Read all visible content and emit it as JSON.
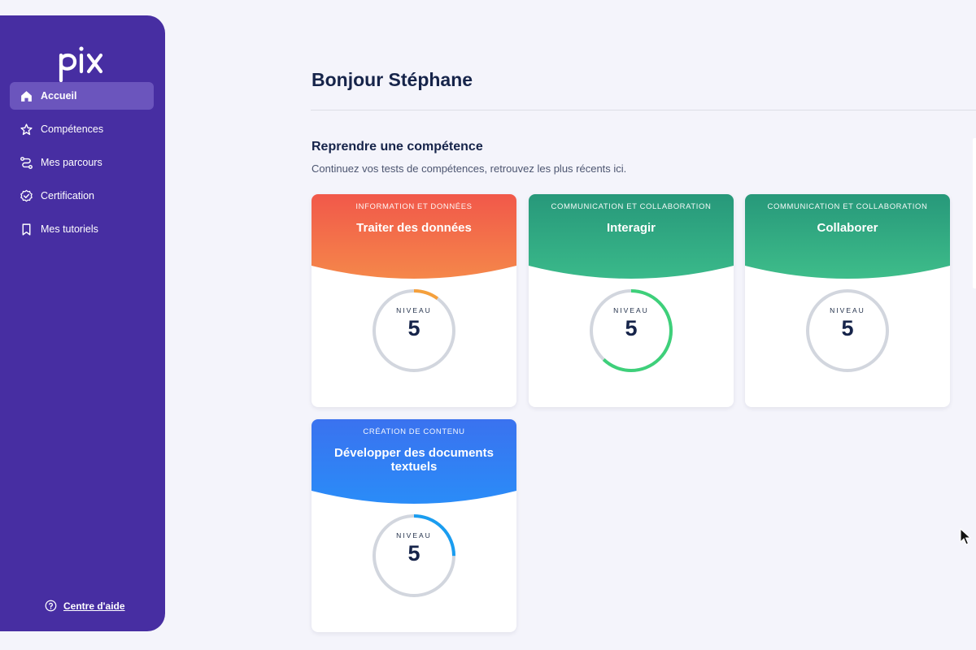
{
  "brand": {
    "logo_text": "pix"
  },
  "sidebar": {
    "items": [
      {
        "label": "Accueil",
        "icon": "home-icon",
        "active": true
      },
      {
        "label": "Compétences",
        "icon": "star-icon",
        "active": false
      },
      {
        "label": "Mes parcours",
        "icon": "route-icon",
        "active": false
      },
      {
        "label": "Certification",
        "icon": "badge-check-icon",
        "active": false
      },
      {
        "label": "Mes tutoriels",
        "icon": "bookmark-icon",
        "active": false
      }
    ],
    "help_label": "Centre d'aide"
  },
  "main": {
    "greeting": "Bonjour Stéphane",
    "section_title": "Reprendre une compétence",
    "section_subtitle": "Continuez vos tests de compétences, retrouvez les plus récents ici."
  },
  "cards": [
    {
      "area": "INFORMATION ET DONNÉES",
      "name": "Traiter des données",
      "level_label": "NIVEAU",
      "level": "5",
      "progress": 0.1,
      "colors": [
        "#f1584a",
        "#f5874a"
      ],
      "progress_color": "#f5a03c"
    },
    {
      "area": "COMMUNICATION ET COLLABORATION",
      "name": "Interagir",
      "level_label": "NIVEAU",
      "level": "5",
      "progress": 0.62,
      "colors": [
        "#27987a",
        "#3ab98a"
      ],
      "progress_color": "#3ed07a"
    },
    {
      "area": "COMMUNICATION ET COLLABORATION",
      "name": "Collaborer",
      "level_label": "NIVEAU",
      "level": "5",
      "progress": 0,
      "colors": [
        "#27987a",
        "#3ebd8a"
      ],
      "progress_color": "#3ed07a"
    },
    {
      "area": "CRÉATION DE CONTENU",
      "name": "Développer des documents textuels",
      "level_label": "NIVEAU",
      "level": "5",
      "progress": 0.25,
      "colors": [
        "#3a72ef",
        "#2a8cf8"
      ],
      "progress_color": "#1a9df0"
    }
  ],
  "colors": {
    "sidebar_bg": "#472ea2",
    "sidebar_active": "#6b55bd",
    "gauge_track": "#d2d6de"
  }
}
